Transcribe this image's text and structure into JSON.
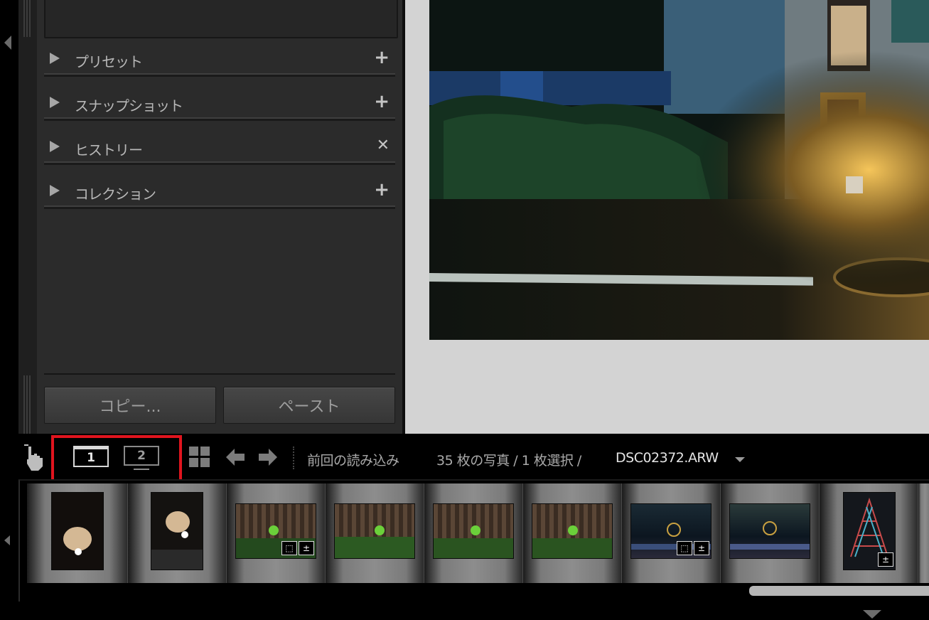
{
  "left_panel": {
    "sections": [
      {
        "label": "プリセット",
        "action": "+"
      },
      {
        "label": "スナップショット",
        "action": "+"
      },
      {
        "label": "ヒストリー",
        "action": "✕"
      },
      {
        "label": "コレクション",
        "action": "+"
      }
    ],
    "copy_button": "コピー...",
    "paste_button": "ペースト"
  },
  "toolbar": {
    "monitor1_label": "1",
    "monitor2_label": "2",
    "source": "前回の読み込み",
    "count_text": "35 枚の写真 / 1 枚選択 /",
    "filename": "DSC02372.ARW",
    "dropdown_icon": "chevron-down-icon"
  },
  "colors": {
    "highlight_box": "#e0141e",
    "panel_bg": "#2b2b2b",
    "viewer_bg": "#d3d3d3"
  },
  "filmstrip": {
    "thumbnails": [
      {
        "badges": []
      },
      {
        "badges": []
      },
      {
        "badges": [
          "crop",
          "adjust"
        ]
      },
      {
        "badges": []
      },
      {
        "badges": []
      },
      {
        "badges": []
      },
      {
        "badges": [
          "crop",
          "adjust"
        ]
      },
      {
        "badges": []
      },
      {
        "badges": [
          "adjust"
        ]
      }
    ]
  }
}
